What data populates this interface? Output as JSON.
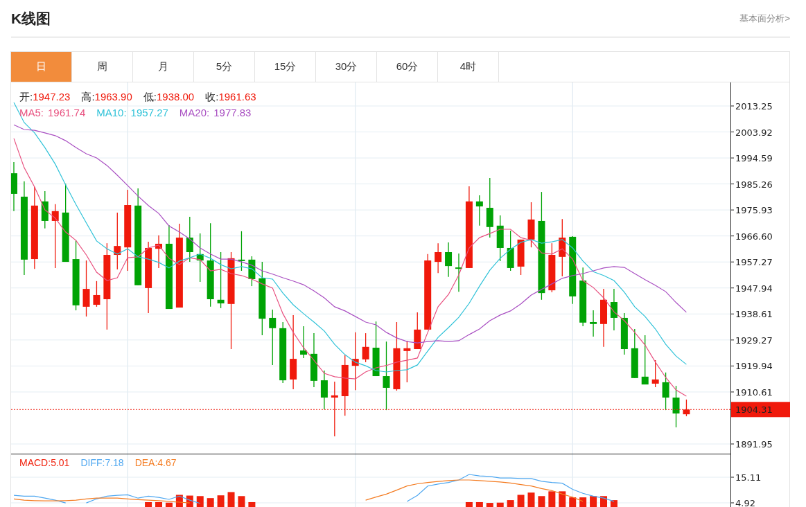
{
  "header": {
    "title": "K线图",
    "link": "基本面分析>"
  },
  "tabs": [
    {
      "label": "日",
      "selected": true
    },
    {
      "label": "周",
      "selected": false
    },
    {
      "label": "月",
      "selected": false
    },
    {
      "label": "5分",
      "selected": false
    },
    {
      "label": "15分",
      "selected": false
    },
    {
      "label": "30分",
      "selected": false
    },
    {
      "label": "60分",
      "selected": false
    },
    {
      "label": "4时",
      "selected": false
    }
  ],
  "kline": {
    "ohlc": [
      {
        "label": "开:",
        "value": "1947.23"
      },
      {
        "label": "高:",
        "value": "1963.90"
      },
      {
        "label": "低:",
        "value": "1938.00"
      },
      {
        "label": "收:",
        "value": "1961.63"
      }
    ],
    "ma_legend": [
      "1961.74",
      "1957.27",
      "1977.83"
    ],
    "chart_data": {
      "type": "candlestick",
      "grid": true,
      "ylim": [
        1888.22,
        2021.7
      ],
      "yticks": [
        {
          "value": 2013.25,
          "label": "2013.25"
        },
        {
          "value": 2003.92,
          "label": "2003.92"
        },
        {
          "value": 1994.59,
          "label": "1994.59"
        },
        {
          "value": 1985.26,
          "label": "1985.26"
        },
        {
          "value": 1975.93,
          "label": "1975.93"
        },
        {
          "value": 1966.6,
          "label": "1966.60"
        },
        {
          "value": 1957.27,
          "label": "1957.27"
        },
        {
          "value": 1947.94,
          "label": "1947.94"
        },
        {
          "value": 1938.61,
          "label": "1938.61"
        },
        {
          "value": 1929.27,
          "label": "1929.27"
        },
        {
          "value": 1919.94,
          "label": "1919.94"
        },
        {
          "value": 1910.61,
          "label": "1910.61"
        },
        {
          "value": 1891.95,
          "label": "1891.95"
        }
      ],
      "ref_lines": [
        {
          "axis": "y",
          "value": 1904.31,
          "label": "1904.31"
        }
      ],
      "ohlc": [
        [
          1989.1,
          1993.1,
          1975.5,
          1981.7
        ],
        [
          1980.7,
          1986.2,
          1952.6,
          1958.1
        ],
        [
          1958.3,
          1984.2,
          1954.8,
          1977.5
        ],
        [
          1979.0,
          1982.7,
          1969.3,
          1972.0
        ],
        [
          1972.0,
          1978.0,
          1955.1,
          1975.5
        ],
        [
          1975.0,
          1985.4,
          1957.3,
          1957.3
        ],
        [
          1958.3,
          1965.0,
          1939.9,
          1941.7
        ],
        [
          1941.2,
          1957.8,
          1937.7,
          1947.6
        ],
        [
          1941.9,
          1950.4,
          1941.2,
          1945.4
        ],
        [
          1943.9,
          1964.0,
          1933.0,
          1959.8
        ],
        [
          1959.8,
          1975.0,
          1954.6,
          1963.0
        ],
        [
          1962.5,
          1983.2,
          1954.1,
          1977.7
        ],
        [
          1977.5,
          1983.7,
          1948.9,
          1948.9
        ],
        [
          1947.9,
          1964.5,
          1938.9,
          1962.3
        ],
        [
          1962.0,
          1966.8,
          1955.1,
          1963.8
        ],
        [
          1963.8,
          1970.5,
          1940.4,
          1940.4
        ],
        [
          1940.9,
          1971.0,
          1940.9,
          1966.0
        ],
        [
          1966.0,
          1973.5,
          1957.3,
          1960.8
        ],
        [
          1960.1,
          1967.5,
          1950.1,
          1957.8
        ],
        [
          1957.8,
          1971.2,
          1941.2,
          1943.9
        ],
        [
          1943.7,
          1960.8,
          1940.7,
          1942.4
        ],
        [
          1942.2,
          1960.8,
          1926.0,
          1958.6
        ],
        [
          1958.1,
          1968.3,
          1954.1,
          1957.6
        ],
        [
          1958.1,
          1959.3,
          1948.6,
          1951.1
        ],
        [
          1951.4,
          1957.3,
          1931.0,
          1936.9
        ],
        [
          1937.2,
          1940.2,
          1920.3,
          1933.5
        ],
        [
          1933.5,
          1935.7,
          1913.8,
          1914.8
        ],
        [
          1915.1,
          1938.2,
          1911.6,
          1922.5
        ],
        [
          1925.5,
          1934.2,
          1922.8,
          1924.0
        ],
        [
          1924.3,
          1931.7,
          1912.3,
          1914.6
        ],
        [
          1914.8,
          1918.3,
          1904.4,
          1908.6
        ],
        [
          1908.6,
          1914.3,
          1894.7,
          1909.4
        ],
        [
          1909.1,
          1923.8,
          1902.1,
          1920.3
        ],
        [
          1920.0,
          1932.0,
          1911.3,
          1922.5
        ],
        [
          1922.3,
          1931.7,
          1921.3,
          1926.8
        ],
        [
          1926.5,
          1935.9,
          1916.3,
          1916.3
        ],
        [
          1916.3,
          1928.7,
          1904.1,
          1912.1
        ],
        [
          1911.6,
          1935.7,
          1911.1,
          1926.3
        ],
        [
          1925.3,
          1929.0,
          1914.1,
          1926.3
        ],
        [
          1926.0,
          1939.2,
          1926.0,
          1933.0
        ],
        [
          1933.0,
          1960.1,
          1933.0,
          1957.8
        ],
        [
          1957.3,
          1964.0,
          1953.3,
          1960.8
        ],
        [
          1960.8,
          1964.3,
          1951.9,
          1955.8
        ],
        [
          1955.3,
          1960.3,
          1946.6,
          1954.8
        ],
        [
          1955.1,
          1984.4,
          1955.1,
          1979.0
        ],
        [
          1979.0,
          1981.2,
          1970.3,
          1977.2
        ],
        [
          1976.7,
          1987.4,
          1966.0,
          1969.8
        ],
        [
          1970.3,
          1974.0,
          1957.6,
          1962.3
        ],
        [
          1962.3,
          1968.5,
          1954.1,
          1955.1
        ],
        [
          1955.6,
          1965.3,
          1952.6,
          1965.3
        ],
        [
          1965.3,
          1978.7,
          1962.5,
          1972.5
        ],
        [
          1972.0,
          1982.4,
          1943.7,
          1946.1
        ],
        [
          1947.1,
          1964.0,
          1946.4,
          1959.8
        ],
        [
          1959.1,
          1972.7,
          1952.1,
          1966.0
        ],
        [
          1966.3,
          1966.5,
          1942.2,
          1944.9
        ],
        [
          1950.6,
          1955.3,
          1934.2,
          1935.5
        ],
        [
          1935.7,
          1939.9,
          1930.5,
          1935.0
        ],
        [
          1935.0,
          1947.6,
          1926.8,
          1943.7
        ],
        [
          1942.9,
          1947.6,
          1932.7,
          1937.2
        ],
        [
          1937.2,
          1938.9,
          1924.0,
          1926.0
        ],
        [
          1926.3,
          1933.2,
          1915.6,
          1915.6
        ],
        [
          1916.1,
          1931.0,
          1913.3,
          1913.3
        ],
        [
          1913.6,
          1922.0,
          1912.3,
          1915.1
        ],
        [
          1914.1,
          1917.6,
          1904.1,
          1908.6
        ],
        [
          1908.6,
          1912.8,
          1897.9,
          1902.9
        ],
        [
          1902.6,
          1907.9,
          1901.9,
          1904.31
        ]
      ],
      "series": [
        {
          "name": "MA5:",
          "type": "line",
          "color": "#e8507f",
          "values": [
            2001.6,
            1991.1,
            1984.2,
            1976.0,
            1973.0,
            1968.0,
            1965.0,
            1959.8,
            1953.6,
            1950.6,
            1951.6,
            1958.8,
            1959.1,
            1962.3,
            1963.3,
            1958.6,
            1956.3,
            1958.8,
            1958.1,
            1954.1,
            1954.6,
            1953.1,
            1952.4,
            1951.1,
            1949.4,
            1947.9,
            1938.7,
            1932.0,
            1926.5,
            1922.0,
            1917.3,
            1916.1,
            1915.6,
            1915.3,
            1917.8,
            1919.3,
            1920.1,
            1921.3,
            1922.0,
            1922.8,
            1932.0,
            1941.2,
            1945.6,
            1952.6,
            1962.3,
            1966.0,
            1967.5,
            1969.0,
            1969.0,
            1966.0,
            1965.0,
            1960.5,
            1960.1,
            1962.0,
            1958.3,
            1950.6,
            1948.1,
            1944.4,
            1939.4,
            1936.2,
            1932.0,
            1927.5,
            1921.3,
            1915.8,
            1911.3,
            1909.1
          ]
        },
        {
          "name": "MA10:",
          "type": "line",
          "color": "#2fc2d8",
          "values": [
            2014.5,
            2007.3,
            2003.6,
            1998.3,
            1992.4,
            1984.9,
            1977.9,
            1971.3,
            1964.8,
            1962.0,
            1960.1,
            1962.0,
            1959.1,
            1958.3,
            1957.1,
            1955.1,
            1957.6,
            1958.8,
            1960.1,
            1958.6,
            1956.3,
            1954.8,
            1955.6,
            1954.8,
            1951.6,
            1951.1,
            1946.1,
            1941.9,
            1938.7,
            1935.7,
            1932.5,
            1927.7,
            1924.0,
            1921.3,
            1920.0,
            1918.3,
            1917.8,
            1918.3,
            1918.6,
            1920.3,
            1925.3,
            1930.2,
            1933.7,
            1937.4,
            1942.4,
            1948.6,
            1954.3,
            1958.6,
            1961.8,
            1964.3,
            1965.3,
            1964.0,
            1964.5,
            1965.3,
            1962.3,
            1957.6,
            1953.8,
            1952.4,
            1950.6,
            1946.4,
            1941.2,
            1937.7,
            1933.2,
            1927.7,
            1923.5,
            1920.5
          ]
        },
        {
          "name": "MA20:",
          "type": "line",
          "color": "#a94fc2",
          "values": [
            2006.5,
            2004.8,
            2004.5,
            2003.6,
            2002.6,
            2000.8,
            1998.3,
            1996.1,
            1994.6,
            1991.9,
            1988.4,
            1984.7,
            1980.9,
            1977.5,
            1974.7,
            1970.2,
            1968.0,
            1965.5,
            1962.3,
            1960.1,
            1958.3,
            1958.3,
            1957.3,
            1956.1,
            1954.1,
            1952.9,
            1951.6,
            1950.4,
            1949.1,
            1946.9,
            1944.4,
            1941.2,
            1939.7,
            1937.7,
            1935.7,
            1934.7,
            1932.0,
            1930.0,
            1928.7,
            1928.2,
            1928.7,
            1929.0,
            1928.7,
            1929.0,
            1931.2,
            1933.2,
            1936.2,
            1938.2,
            1939.7,
            1942.2,
            1945.4,
            1947.4,
            1949.4,
            1951.4,
            1952.4,
            1953.1,
            1954.1,
            1955.1,
            1955.6,
            1955.3,
            1953.1,
            1950.9,
            1948.9,
            1946.6,
            1942.7,
            1939.2
          ]
        }
      ]
    }
  },
  "macd": {
    "legend": [
      "5.01",
      "7.18",
      "4.67"
    ],
    "chart_data": {
      "type": "bar",
      "grid": true,
      "ylim": [
        2.99,
        24.2
      ],
      "yticks": [
        {
          "value": 15.11,
          "label": "15.11"
        },
        {
          "value": 4.92,
          "label": "4.92"
        }
      ],
      "series": [
        {
          "name": "MACD:",
          "type": "bar",
          "color": "#f0200c",
          "values": [
            null,
            null,
            null,
            null,
            null,
            null,
            null,
            null,
            null,
            null,
            null,
            null,
            null,
            5.2,
            5.2,
            5.0,
            8.1,
            7.8,
            7.6,
            6.8,
            7.9,
            9.2,
            7.6,
            5.2,
            null,
            null,
            null,
            null,
            null,
            null,
            null,
            null,
            null,
            null,
            null,
            null,
            null,
            null,
            null,
            null,
            null,
            null,
            null,
            null,
            5.2,
            5.2,
            4.9,
            5.0,
            6.0,
            8.1,
            9.0,
            7.6,
            9.5,
            9.5,
            7.1,
            7.1,
            7.6,
            7.6,
            6.0,
            null,
            null,
            null,
            null,
            null,
            null,
            null
          ]
        },
        {
          "name": "DIFF:",
          "type": "line",
          "color": "#4ea7f0",
          "values": [
            7.9,
            7.6,
            7.6,
            6.8,
            6.0,
            4.9,
            null,
            4.9,
            6.5,
            7.6,
            7.9,
            8.1,
            6.8,
            7.6,
            7.1,
            6.3,
            7.6,
            6.0,
            4.7,
            null,
            null,
            null,
            null,
            null,
            null,
            null,
            null,
            null,
            null,
            null,
            null,
            null,
            null,
            null,
            null,
            null,
            null,
            null,
            5.5,
            7.9,
            11.6,
            12.4,
            13.0,
            14.0,
            16.2,
            15.6,
            15.4,
            14.8,
            14.8,
            14.6,
            14.6,
            13.5,
            13.0,
            12.7,
            10.3,
            8.7,
            7.6,
            6.8,
            5.5,
            null,
            null,
            null,
            null,
            null,
            null,
            null
          ]
        },
        {
          "name": "DEA:",
          "type": "line",
          "color": "#f47b20",
          "values": [
            6.5,
            6.0,
            5.8,
            5.7,
            5.7,
            5.8,
            6.0,
            6.5,
            6.8,
            6.8,
            6.8,
            6.5,
            6.2,
            6.0,
            5.8,
            5.5,
            5.2,
            4.9,
            null,
            null,
            null,
            null,
            null,
            null,
            null,
            null,
            null,
            null,
            null,
            null,
            null,
            null,
            null,
            null,
            6.0,
            7.2,
            8.4,
            10.0,
            11.6,
            12.5,
            13.0,
            13.4,
            13.8,
            14.0,
            14.0,
            13.8,
            13.5,
            13.2,
            12.8,
            12.2,
            11.6,
            10.6,
            9.8,
            8.4,
            7.2,
            5.5,
            null,
            null,
            null,
            null,
            null,
            null,
            null,
            null,
            null,
            null
          ]
        }
      ]
    }
  }
}
